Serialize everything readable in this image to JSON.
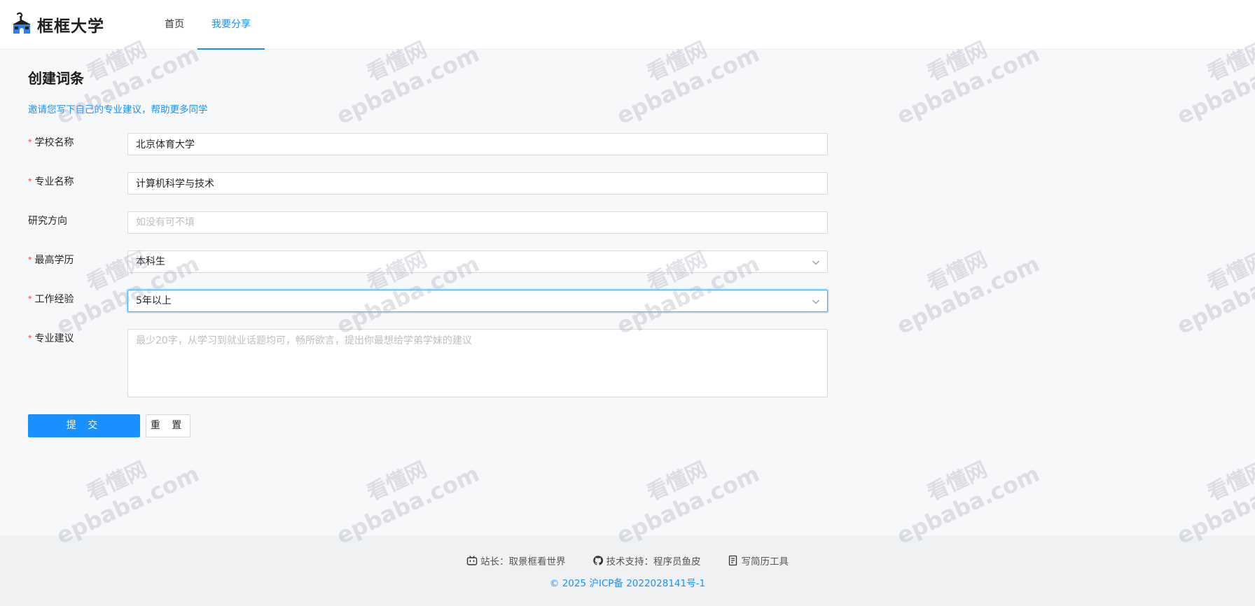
{
  "header": {
    "logo_text": "框框大学",
    "nav": [
      {
        "label": "首页",
        "active": false
      },
      {
        "label": "我要分享",
        "active": true
      }
    ]
  },
  "main": {
    "title": "创建词条",
    "subtitle": "邀请您写下自己的专业建议，帮助更多同学",
    "form": {
      "school": {
        "label": "学校名称",
        "required": true,
        "value": "北京体育大学"
      },
      "major": {
        "label": "专业名称",
        "required": true,
        "value": "计算机科学与技术"
      },
      "direction": {
        "label": "研究方向",
        "required": false,
        "value": "",
        "placeholder": "如没有可不填"
      },
      "degree": {
        "label": "最高学历",
        "required": true,
        "value": "本科生"
      },
      "experience": {
        "label": "工作经验",
        "required": true,
        "value": "5年以上"
      },
      "advice": {
        "label": "专业建议",
        "required": true,
        "value": "",
        "placeholder": "最少20字，从学习到就业话题均可，畅所欲言，提出你最想给学弟学妹的建议"
      }
    },
    "buttons": {
      "submit": "提 交",
      "reset": "重 置"
    }
  },
  "footer": {
    "owner": "站长：取景框看世界",
    "support": "技术支持：程序员鱼皮",
    "tool": "写简历工具",
    "copyright": "© 2025 沪ICP备 2022028141号-1"
  },
  "watermark": {
    "line1": "看懂网",
    "line2": "epbaba.com"
  },
  "colors": {
    "accent": "#1890ff",
    "required": "#ff4d4f"
  }
}
